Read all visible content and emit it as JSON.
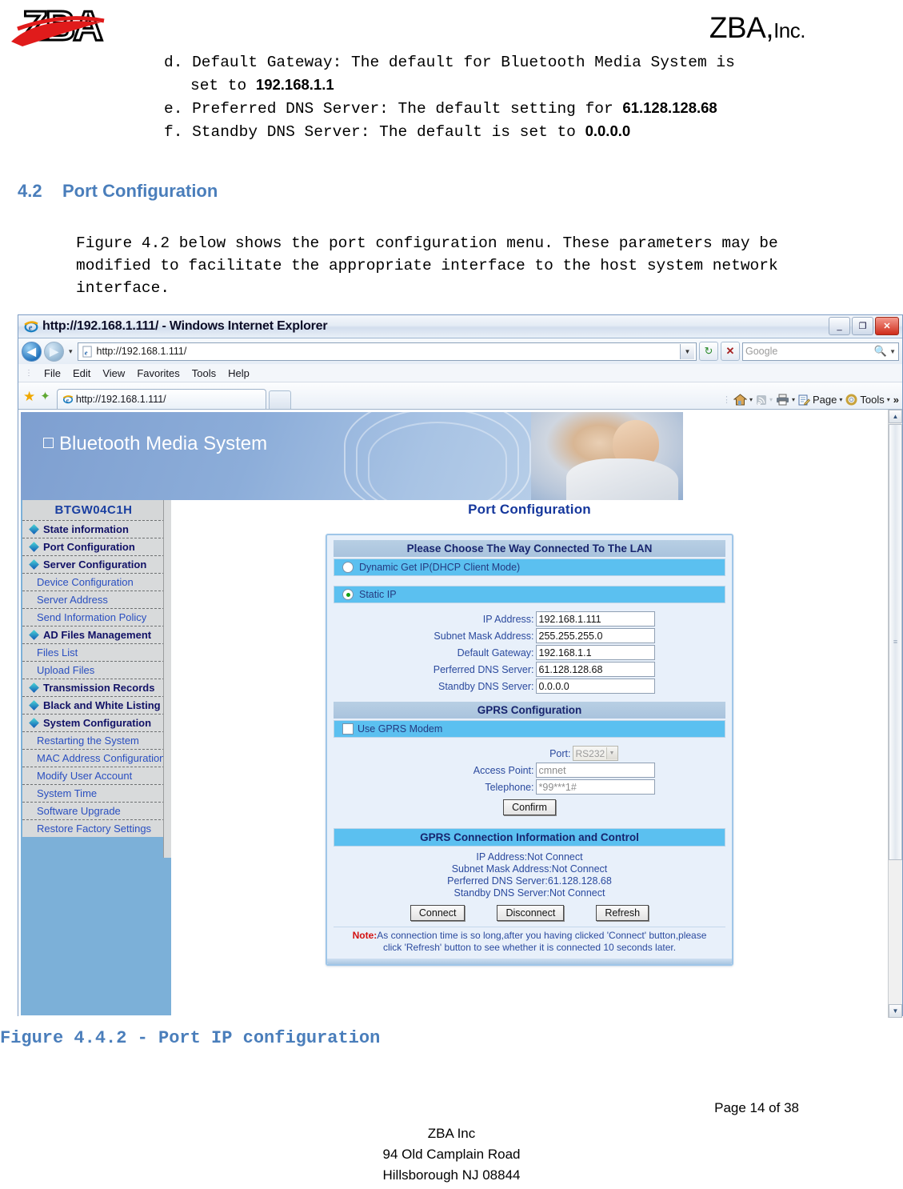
{
  "doc": {
    "company_name": "ZBA,",
    "company_suffix": "Inc.",
    "logo_text": "ZBA",
    "list_items": [
      {
        "marker": "d.",
        "line1": "Default Gateway: The default for Bluetooth Media System is",
        "line2_prefix": "set to ",
        "line2_bold": "192.168.1.1"
      },
      {
        "marker": "e.",
        "line1_prefix": "Preferred DNS Server: The default setting for ",
        "line1_bold": "61.128.128.68"
      },
      {
        "marker": "f.",
        "line1_prefix": "Standby DNS Server: The default is set to ",
        "line1_bold": "0.0.0.0"
      }
    ],
    "section_number": "4.2",
    "section_title": "Port Configuration",
    "paragraph": "Figure 4.2 below shows the port configuration menu. These parameters may be modified to facilitate the appropriate interface to the host system network interface.",
    "figure_caption": "Figure 4.4.2 - Port IP configuration",
    "page_number": "Page 14 of 38",
    "footer_lines": [
      "ZBA Inc",
      "94 Old Camplain Road",
      "Hillsborough NJ 08844"
    ]
  },
  "browser": {
    "window_title": "http://192.168.1.111/ - Windows Internet Explorer",
    "url": "http://192.168.1.111/",
    "search_placeholder": "Google",
    "window_buttons": {
      "minimize": "_",
      "restore": "❐",
      "close": "✕"
    },
    "nav": {
      "back": "◀",
      "forward": "▶",
      "history_caret": "▾",
      "refresh": "↻",
      "stop": "✕"
    },
    "menu_items": [
      "File",
      "Edit",
      "View",
      "Favorites",
      "Tools",
      "Help"
    ],
    "tab_title": "http://192.168.1.111/",
    "command_bar": [
      {
        "label": "",
        "icon": "home-icon",
        "caret": "▾"
      },
      {
        "label": "",
        "icon": "feeds-icon",
        "caret": "▾"
      },
      {
        "label": "",
        "icon": "print-icon",
        "caret": "▾"
      },
      {
        "label": "Page",
        "icon": "page-icon",
        "caret": "▾"
      },
      {
        "label": "Tools",
        "icon": "tools-icon",
        "caret": "▾"
      }
    ],
    "command_overflow": "»"
  },
  "webpage": {
    "banner_title": "Bluetooth Media System",
    "sidebar": {
      "header": "BTGW04C1H",
      "items": [
        {
          "label": "State information",
          "type": "top"
        },
        {
          "label": "Port Configuration",
          "type": "top"
        },
        {
          "label": "Server Configuration",
          "type": "top"
        },
        {
          "label": "Device Configuration",
          "type": "sub"
        },
        {
          "label": "Server Address",
          "type": "sub"
        },
        {
          "label": "Send Information Policy",
          "type": "sub"
        },
        {
          "label": "AD Files Management",
          "type": "top"
        },
        {
          "label": "Files List",
          "type": "sub"
        },
        {
          "label": "Upload Files",
          "type": "sub"
        },
        {
          "label": "Transmission Records",
          "type": "top"
        },
        {
          "label": "Black and White Listing",
          "type": "top"
        },
        {
          "label": "System Configuration",
          "type": "top"
        },
        {
          "label": "Restarting the System",
          "type": "sub"
        },
        {
          "label": "MAC Address Configuration",
          "type": "sub"
        },
        {
          "label": "Modify User Account",
          "type": "sub"
        },
        {
          "label": "System Time",
          "type": "sub"
        },
        {
          "label": "Software Upgrade",
          "type": "sub"
        },
        {
          "label": "Restore Factory Settings",
          "type": "sub"
        }
      ]
    },
    "page_title": "Port Configuration",
    "lan_section": {
      "header": "Please Choose The Way Connected To The LAN",
      "option_dhcp": "Dynamic Get IP(DHCP Client Mode)",
      "option_static": "Static IP",
      "selected": "static",
      "fields": [
        {
          "label": "IP Address:",
          "value": "192.168.1.111"
        },
        {
          "label": "Subnet Mask Address:",
          "value": "255.255.255.0"
        },
        {
          "label": "Default Gateway:",
          "value": "192.168.1.1"
        },
        {
          "label": "Perferred DNS Server:",
          "value": "61.128.128.68"
        },
        {
          "label": "Standby DNS Server:",
          "value": "0.0.0.0"
        }
      ]
    },
    "gprs_section": {
      "header": "GPRS Configuration",
      "use_modem_label": "Use GPRS Modem",
      "use_modem_checked": false,
      "port_label": "Port:",
      "port_value": "RS232",
      "access_point_label": "Access Point:",
      "access_point_value": "cmnet",
      "telephone_label": "Telephone:",
      "telephone_value": "*99***1#",
      "confirm_button": "Confirm"
    },
    "gprs_status": {
      "header": "GPRS Connection Information and Control",
      "lines": [
        "IP Address:Not Connect",
        "Subnet Mask Address:Not Connect",
        "Perferred DNS Server:61.128.128.68",
        "Standby DNS Server:Not Connect"
      ],
      "buttons": [
        "Connect",
        "Disconnect",
        "Refresh"
      ],
      "note_label": "Note:",
      "note_line1": "As connection time is so long,after you having clicked 'Connect' button,please",
      "note_line2": "click 'Refresh' button to see whether it is connected 10 seconds later."
    },
    "scrollbar": {
      "up": "▲",
      "down": "▼"
    }
  },
  "colors": {
    "heading_blue": "#4a7ebb",
    "sidebar_blue": "#7cb0d8",
    "bar_cyan": "#5bc0f0",
    "label_blue": "#2b4a9e",
    "note_red": "#d31010"
  }
}
